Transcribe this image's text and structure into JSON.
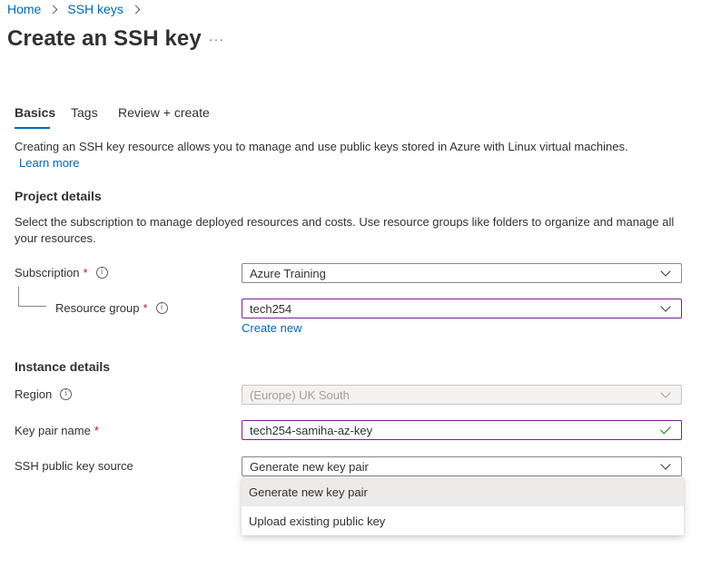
{
  "breadcrumb": {
    "home": "Home",
    "ssh_keys": "SSH keys"
  },
  "page": {
    "title": "Create an SSH key",
    "more": "···"
  },
  "tabs": [
    {
      "label": "Basics"
    },
    {
      "label": "Tags"
    },
    {
      "label": "Review + create"
    }
  ],
  "intro": {
    "text": "Creating an SSH key resource allows you to manage and use public keys stored in Azure with Linux virtual machines.",
    "learn_more": "Learn more"
  },
  "project": {
    "heading": "Project details",
    "description": "Select the subscription to manage deployed resources and costs. Use resource groups like folders to organize and manage all your resources.",
    "subscription_label": "Subscription",
    "subscription_value": "Azure Training",
    "resource_group_label": "Resource group",
    "resource_group_value": "tech254",
    "create_new": "Create new"
  },
  "instance": {
    "heading": "Instance details",
    "region_label": "Region",
    "region_value": "(Europe) UK South",
    "key_pair_label": "Key pair name",
    "key_pair_value": "tech254-samiha-az-key",
    "ssh_source_label": "SSH public key source",
    "ssh_source_value": "Generate new key pair",
    "ssh_source_options": [
      "Generate new key pair",
      "Upload existing public key"
    ]
  },
  "required_marker": "*",
  "info_glyph": "i",
  "colors": {
    "link": "#0067b8",
    "required": "#a4262c",
    "focus": "#7a1f9a",
    "valid": "#107c10"
  }
}
